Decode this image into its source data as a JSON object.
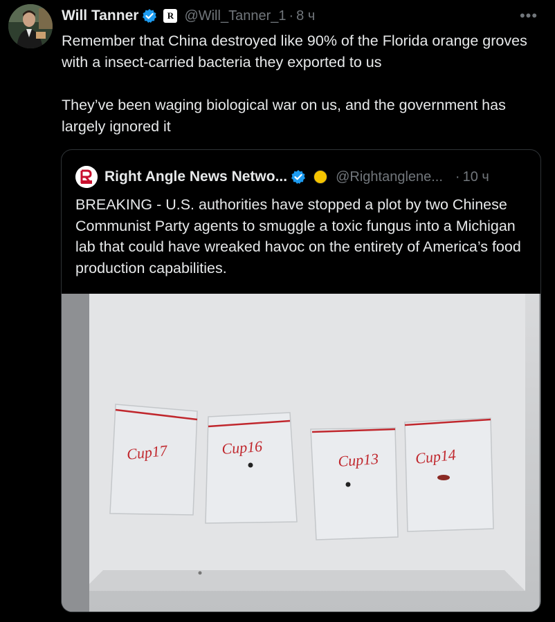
{
  "tweet": {
    "author_name": "Will Tanner",
    "affiliation_badge": "R",
    "handle": "@Will_Tanner_1",
    "separator": "·",
    "time": "8 ч",
    "more_icon": "•••",
    "text": "Remember that China destroyed like 90% of the Florida orange groves with a insect-carried bacteria they exported to us\n\nThey’ve been waging biological war on us, and the government has largely ignored it"
  },
  "quote": {
    "author_name": "Right Angle News Netwo...",
    "handle": "@Rightanglene...",
    "separator": "·",
    "time": "10 ч",
    "text": "BREAKING - U.S. authorities have stopped a plot by two Chinese Communist Party agents to smuggle a toxic fungus into a Michigan lab that could have wreaked havoc on the entirety of America’s food production capabilities.",
    "photo": {
      "bag_labels": [
        "Cup17",
        "Cup16",
        "Cup13",
        "Cup14"
      ]
    }
  },
  "colors": {
    "background": "#000000",
    "text_primary": "#e7e9ea",
    "text_secondary": "#71767b",
    "verified_blue": "#1d9bf0",
    "border": "#2f3336",
    "quote_avatar_red": "#c8102e"
  }
}
